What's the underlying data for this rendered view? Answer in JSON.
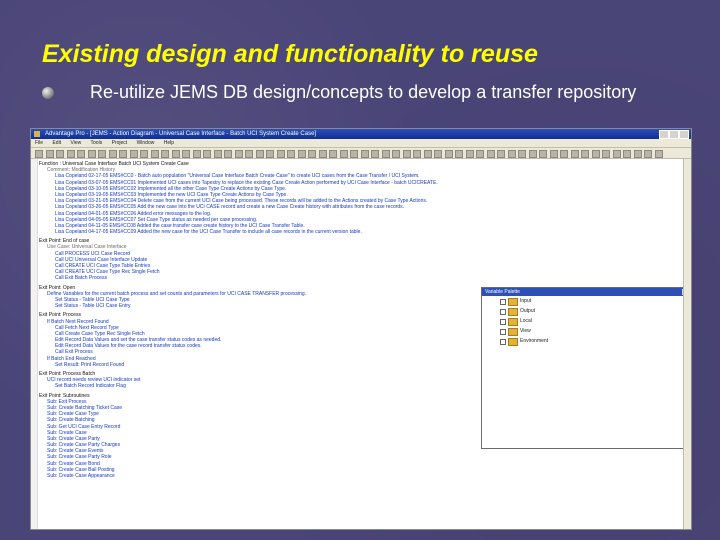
{
  "slide": {
    "title": "Existing design and functionality to reuse",
    "bullet": "Re-utilize JEMS DB design/concepts to develop a transfer repository"
  },
  "app": {
    "title": "Advantage Pro - [JEMS - Action Diagram - Universal Case Interface - Batch UCI System Create Case]",
    "menu": [
      "File",
      "Edit",
      "View",
      "Tools",
      "Project",
      "Window",
      "Help"
    ]
  },
  "script_lines": [
    {
      "t": "Function : Universal Case Interface Batch UCI System Create Case",
      "c": "dark",
      "i": 0
    },
    {
      "t": "Comment: Modification History",
      "c": "gray",
      "i": 1
    },
    {
      "t": "Lisa Copeland 02-17-05 EMS#CC0 - Batch auto population \"Universal Case Interface Batch Create Case\" to create UCI cases from the Case Transfer / UCI System.",
      "c": "blue",
      "i": 2
    },
    {
      "t": "Lisa Copeland 03-07-05 EMS#CC01 Implemented UCI cases into Tapestry to replace the existing Case Create Action performed by UCI Case Interface - batch UCICREATE.",
      "c": "blue",
      "i": 2
    },
    {
      "t": "Lisa Copeland 03-10-05 EMS#CC02 Implemented all the other Case Type Create Actions by Case Type.",
      "c": "blue",
      "i": 2
    },
    {
      "t": "Lisa Copeland 03-19-05 EMS#CC03 Implemented the new UCI Case Type Create Actions by Case Type.",
      "c": "blue",
      "i": 2
    },
    {
      "t": "Lisa Copeland 03-21-05 EMS#CC04 Delete case from the current UCI Case being processed. These records will be added to the Actions created by Case Type Actions.",
      "c": "blue",
      "i": 2
    },
    {
      "t": "Lisa Copeland 03-26-05 EMS#CC05 Add the new case into the UCI CASE record and create a new Case Create history with attributes from the case records.",
      "c": "blue",
      "i": 2
    },
    {
      "t": "Lisa Copeland 04-01-05 EMS#CC06 Added error messages to the log.",
      "c": "blue",
      "i": 2
    },
    {
      "t": "Lisa Copeland 04-05-05 EMS#CC07 Set Case Type status as needed per case processing.",
      "c": "blue",
      "i": 2
    },
    {
      "t": "Lisa Copeland 04-11-05 EMS#CC08 Added the case transfer case create history to the UCI Case Transfer Table.",
      "c": "blue",
      "i": 2
    },
    {
      "t": "Lisa Copeland 04-17-05 EMS#CC09 Added the new case for the UCI Case Transfer to include all case records in the current version table.",
      "c": "blue",
      "i": 2
    },
    {
      "t": "",
      "c": "sep",
      "i": 0
    },
    {
      "t": "Exit Point: End of case",
      "c": "dark",
      "i": 0
    },
    {
      "t": "Use Case: Universal Case Interface",
      "c": "gray",
      "i": 1
    },
    {
      "t": "Call PROCESS UCI Case Record",
      "c": "blue",
      "i": 2
    },
    {
      "t": "Call UCI Universal Case Interface Update",
      "c": "blue",
      "i": 2
    },
    {
      "t": "Call CREATE UCI Case Type Table Entries",
      "c": "blue",
      "i": 2
    },
    {
      "t": "Call CREATE UCI Case Type Rec Single Fetch",
      "c": "blue",
      "i": 2
    },
    {
      "t": "Call Exit Batch Process",
      "c": "blue",
      "i": 2
    },
    {
      "t": "",
      "c": "sep",
      "i": 0
    },
    {
      "t": "Exit Point: Open",
      "c": "dark",
      "i": 0
    },
    {
      "t": "Define Variables for the current batch process and set counts and parameters for UCI CASE TRANSFER processing.",
      "c": "blue",
      "i": 1
    },
    {
      "t": "Set Status - Table UCI Case Type",
      "c": "blue",
      "i": 2
    },
    {
      "t": "Set Status - Table UCI Case Entry",
      "c": "blue",
      "i": 2
    },
    {
      "t": "",
      "c": "sep",
      "i": 0
    },
    {
      "t": "Exit Point: Process",
      "c": "dark",
      "i": 0
    },
    {
      "t": "If Batch Next Record Found",
      "c": "blue",
      "i": 1
    },
    {
      "t": "Call Fetch Next Record Type",
      "c": "blue",
      "i": 2
    },
    {
      "t": "Call Create Case Type Rec Single Fetch",
      "c": "blue",
      "i": 2
    },
    {
      "t": "Edit Record Data Values and set the case transfer status codes as needed.",
      "c": "blue",
      "i": 2
    },
    {
      "t": "Edit Record Data Values for the case record transfer status codes.",
      "c": "blue",
      "i": 2
    },
    {
      "t": "Call Exit Process",
      "c": "blue",
      "i": 2
    },
    {
      "t": "If Batch End Reached",
      "c": "blue",
      "i": 1
    },
    {
      "t": "Set Result: Print Record Found",
      "c": "blue",
      "i": 2
    },
    {
      "t": "",
      "c": "sep",
      "i": 0
    },
    {
      "t": "Exit Point: Process Batch",
      "c": "dark",
      "i": 0
    },
    {
      "t": "UCI record needs review UCI indicator set",
      "c": "blue",
      "i": 1
    },
    {
      "t": "Set Batch Record Indicator Flag",
      "c": "blue",
      "i": 2
    },
    {
      "t": "",
      "c": "sep",
      "i": 0
    },
    {
      "t": "Exit Point: Subroutines",
      "c": "dark",
      "i": 0
    },
    {
      "t": "Sub: Exit Process",
      "c": "blue",
      "i": 1
    },
    {
      "t": "Sub: Create Batching Ticket Case",
      "c": "blue",
      "i": 1
    },
    {
      "t": "Sub: Create Case Type",
      "c": "blue",
      "i": 1
    },
    {
      "t": "Sub: Create Batching",
      "c": "blue",
      "i": 1
    },
    {
      "t": "Sub: Get UCI Case Entry Record",
      "c": "blue",
      "i": 1
    },
    {
      "t": "Sub: Create Case",
      "c": "blue",
      "i": 1
    },
    {
      "t": "Sub: Create Case Party",
      "c": "blue",
      "i": 1
    },
    {
      "t": "Sub: Create Case Party Charges",
      "c": "blue",
      "i": 1
    },
    {
      "t": "Sub: Create Case Events",
      "c": "blue",
      "i": 1
    },
    {
      "t": "Sub: Create Case Party Role",
      "c": "blue",
      "i": 1
    },
    {
      "t": "Sub: Create Case Bond",
      "c": "blue",
      "i": 1
    },
    {
      "t": "Sub: Create Case Bail Posting",
      "c": "blue",
      "i": 1
    },
    {
      "t": "Sub: Create Case Appearance",
      "c": "blue",
      "i": 1
    }
  ],
  "palette": {
    "title": "Variable Palette",
    "items": [
      "Input",
      "Output",
      "Local",
      "View",
      "Environment"
    ]
  }
}
